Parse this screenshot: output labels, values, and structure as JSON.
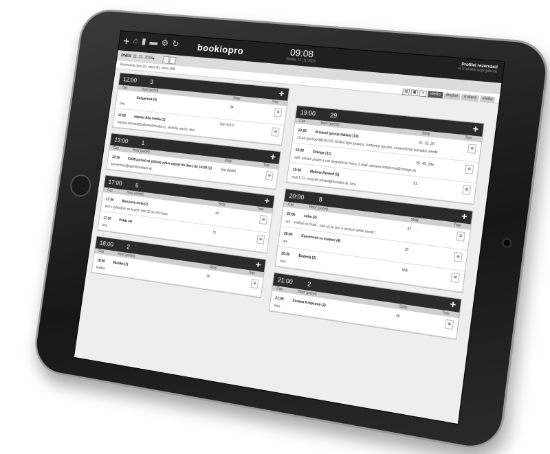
{
  "app": {
    "logo": "bookiopro",
    "time": "09:08",
    "time_sub": "Streda, 12. 11. 2015",
    "user_name": "Profilel rezervácií",
    "user_sub": "nl V sedení najd gdbt nk"
  },
  "toolbar": {
    "icons": [
      "plus-icon",
      "home-icon",
      "book-icon",
      "car-icon",
      "gear-icon",
      "refresh-icon"
    ]
  },
  "date": {
    "label": "DNES",
    "value": "11. 11. 2015",
    "prev": "‹",
    "next": "›"
  },
  "filter": "Rezervácie ráno (0), obed (4), večer (48)",
  "views": {
    "buttons": [
      "všetko",
      "dnešné",
      "zrušené",
      "všetky"
    ]
  },
  "columns": {
    "time": "Čas",
    "guest": "Hosť (počet)",
    "table": "Stoly",
    "pay": "Trav"
  },
  "left": [
    {
      "time": "12:00",
      "count": "3",
      "rows": [
        {
          "time": "",
          "guest": "Gašparová (3)",
          "table": "34",
          "status": "",
          "note": "bea"
        },
        {
          "time": "12:00",
          "guest": "napísat Alta media (1)",
          "table": "",
          "status": "ON HOLD",
          "note": "martina.perestat@alfamedimedia.cz, skončia opoče, bea"
        }
      ]
    },
    {
      "time": "13:00",
      "count": "1",
      "rows": [
        {
          "time": "13:30",
          "guest": "KAMI (privat na pištok) výber napojí do dnes do 14:00 (1)",
          "table": "Bar Apollo",
          "status": "",
          "note": "kamenicka@agentkurakam.sk"
        }
      ]
    },
    {
      "time": "17:00",
      "count": "6",
      "rows": [
        {
          "time": "17:00",
          "guest": "Weiszová Iveta (2)",
          "table": "34",
          "status": "",
          "note": "stol s výhľadom na hrad!!! Stol 32 do 35!!! bea"
        },
        {
          "time": "17:30",
          "guest": "Pekár (4)",
          "table": "31",
          "status": "",
          "note": "bea"
        }
      ]
    },
    {
      "time": "18:00",
      "count": "2",
      "rows": [
        {
          "time": "18:00",
          "guest": "Monika (2)",
          "table": "36",
          "status": "",
          "note": "Radka"
        }
      ]
    }
  ],
  "right": [
    {
      "time": "19:00",
      "count": "29",
      "rows": [
        {
          "time": "19:00",
          "guest": "B-travel (group Italian) (13)",
          "table": "32, 33, 35",
          "status": "",
          "note": "19:45 príchod MENU 02: Grilled tiger prawns, butternut squash, caramelized pumpkin seeds"
        },
        {
          "time": "19:00",
          "guest": "Orange (11)",
          "table": "36, 40, 39a",
          "status": "",
          "note": "edit: uznam posiel a cas degustacie menu 3 mail: adriana.nosterova@orange.sk"
        },
        {
          "time": "19:30",
          "guest": "Malone Renard (5)",
          "table": "31",
          "status": "",
          "note": "mail 5.11. renarde.renard@foreignr.sk, bea"
        }
      ]
    },
    {
      "time": "20:00",
      "count": "8",
      "rows": [
        {
          "time": "20:00",
          "guest": "seba (2)",
          "table": "37",
          "status": "",
          "note": "ani .. vyhľad na hrad... pán už to isto a nechce veľké meati !"
        },
        {
          "time": "20:00",
          "guest": "Kamenová vs kramer (4)",
          "table": "35",
          "status": "",
          "note": "ani"
        },
        {
          "time": "20:30",
          "guest": "Budenij (2)",
          "table": "506",
          "status": "",
          "note": "bea"
        }
      ]
    },
    {
      "time": "21:00",
      "count": "2",
      "rows": [
        {
          "time": "21:00",
          "guest": "Zuzana Krapcová (2)",
          "table": "35",
          "status": "",
          "note": "bea"
        }
      ]
    }
  ]
}
